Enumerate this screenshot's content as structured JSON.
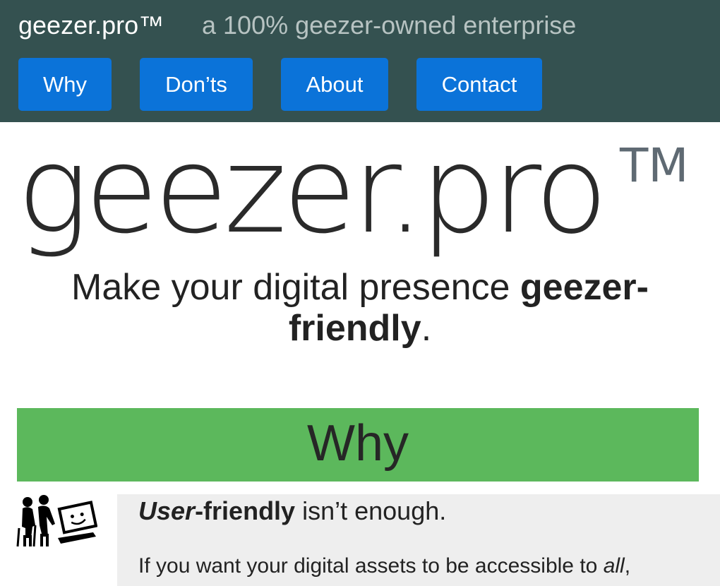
{
  "header": {
    "brand": "geezer.pro™",
    "tagline": "a 100% geezer-owned enterprise",
    "nav": [
      {
        "label": "Why"
      },
      {
        "label": "Don’ts"
      },
      {
        "label": "About"
      },
      {
        "label": "Contact"
      }
    ]
  },
  "hero": {
    "title": "geezer.pro",
    "trademark": "TM",
    "subtitle_before": "Make your digital presence ",
    "subtitle_bold": "geezer-friendly",
    "subtitle_after": "."
  },
  "why": {
    "banner": "Why",
    "illustration_icon": "elderly-couple-laptop-icon",
    "heading_italic_bold": "User",
    "heading_bold": "-friendly",
    "heading_rest": " isn’t enough.",
    "body_before": "If you want your digital assets to be accessible to ",
    "body_italic": "all",
    "body_after": ","
  },
  "colors": {
    "header_bg": "#345150",
    "nav_button": "#0b73d9",
    "why_banner": "#5cb85c",
    "card_bg": "#eeeeee"
  }
}
